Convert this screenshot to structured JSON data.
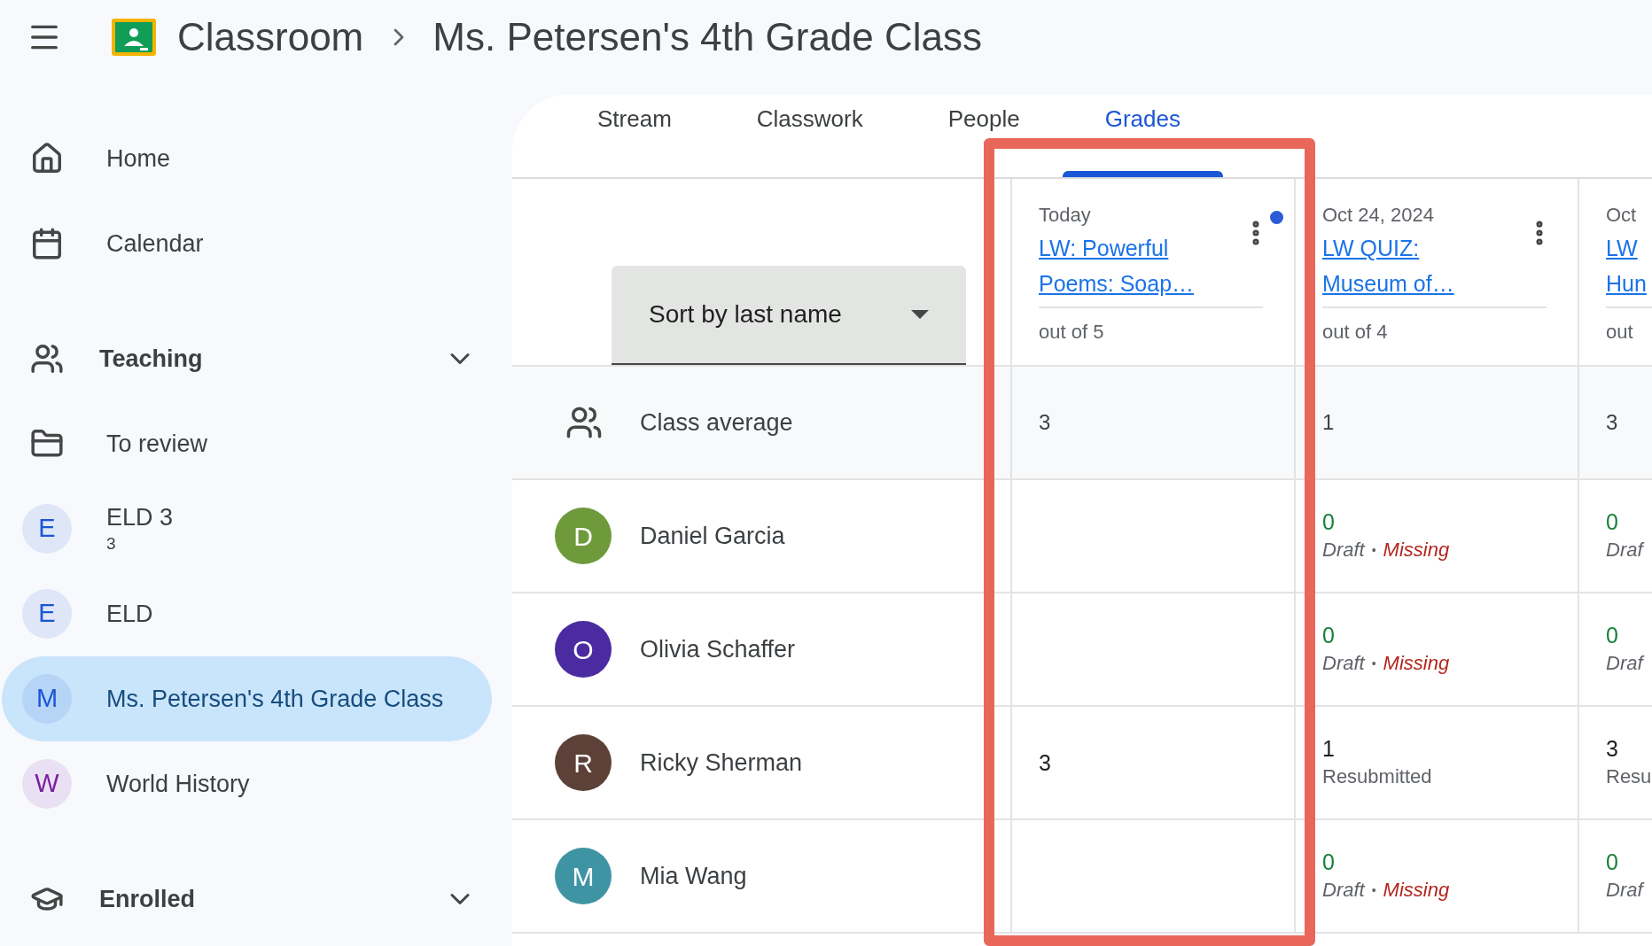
{
  "header": {
    "app_name": "Classroom",
    "breadcrumb": "Ms. Petersen's 4th Grade Class"
  },
  "sidebar": [
    {
      "kind": "home",
      "label": "Home",
      "selected": false
    },
    {
      "kind": "calendar",
      "label": "Calendar",
      "selected": false
    },
    {
      "kind": "teaching",
      "label": "Teaching",
      "selected": false
    },
    {
      "kind": "review",
      "label": "To review",
      "selected": false
    },
    {
      "kind": "class",
      "letter": "E",
      "label": "ELD 3",
      "sub": "3",
      "color": "#1a56d6",
      "selected": false
    },
    {
      "kind": "class",
      "letter": "E",
      "label": "ELD",
      "color": "#1a56d6",
      "selected": false
    },
    {
      "kind": "class",
      "letter": "M",
      "label": "Ms. Petersen's 4th Grade Class",
      "color": "#1a56d6",
      "selected": true
    },
    {
      "kind": "class",
      "letter": "W",
      "label": "World History",
      "color": "#7b1fa2",
      "selected": false
    },
    {
      "kind": "enrolled",
      "label": "Enrolled",
      "selected": false
    }
  ],
  "tabs": [
    {
      "label": "Stream",
      "selected": false
    },
    {
      "label": "Classwork",
      "selected": false
    },
    {
      "label": "People",
      "selected": false
    },
    {
      "label": "Grades",
      "selected": true
    }
  ],
  "sort": {
    "value": "Sort by last name"
  },
  "columns": [
    {
      "date": "Today",
      "title": "LW: Powerful Poems: Soap…",
      "points": "out of 5",
      "unread": true,
      "menu": true
    },
    {
      "date": "Oct 24, 2024",
      "title": "LW QUIZ: Museum of…",
      "points": "out of 4",
      "unread": false,
      "menu": true
    },
    {
      "date": "Oct",
      "title": "LW Hun",
      "points": "out",
      "unread": false,
      "menu": false
    }
  ],
  "class_average": {
    "label": "Class average",
    "values": [
      "3",
      "1",
      "3"
    ]
  },
  "students": [
    {
      "initial": "D",
      "name": "Daniel Garcia",
      "color": "#6f9a3c",
      "cells": [
        {},
        {
          "grade": "0",
          "draft": true,
          "status": [
            {
              "kind": "draft",
              "text": "Draft"
            },
            {
              "kind": "separator",
              "text": "•"
            },
            {
              "kind": "missing",
              "text": "Missing"
            }
          ]
        },
        {
          "grade": "0",
          "draft": true,
          "status": [
            {
              "kind": "draft",
              "text": "Draf"
            }
          ]
        }
      ]
    },
    {
      "initial": "O",
      "name": "Olivia Schaffer",
      "color": "#4a2ca0",
      "cells": [
        {},
        {
          "grade": "0",
          "draft": true,
          "status": [
            {
              "kind": "draft",
              "text": "Draft"
            },
            {
              "kind": "separator",
              "text": "•"
            },
            {
              "kind": "missing",
              "text": "Missing"
            }
          ]
        },
        {
          "grade": "0",
          "draft": true,
          "status": [
            {
              "kind": "draft",
              "text": "Draf"
            }
          ]
        }
      ]
    },
    {
      "initial": "R",
      "name": "Ricky Sherman",
      "color": "#5d4037",
      "cells": [
        {
          "grade": "3",
          "draft": false
        },
        {
          "grade": "1",
          "draft": false,
          "status": [
            {
              "kind": "plain",
              "text": "Resubmitted"
            }
          ]
        },
        {
          "grade": "3",
          "draft": false,
          "status": [
            {
              "kind": "plain",
              "text": "Resu"
            }
          ]
        }
      ]
    },
    {
      "initial": "M",
      "name": "Mia Wang",
      "color": "#3f94a4",
      "cells": [
        {},
        {
          "grade": "0",
          "draft": true,
          "status": [
            {
              "kind": "draft",
              "text": "Draft"
            },
            {
              "kind": "separator",
              "text": "•"
            },
            {
              "kind": "missing",
              "text": "Missing"
            }
          ]
        },
        {
          "grade": "0",
          "draft": true,
          "status": [
            {
              "kind": "draft",
              "text": "Draf"
            }
          ]
        }
      ]
    }
  ]
}
